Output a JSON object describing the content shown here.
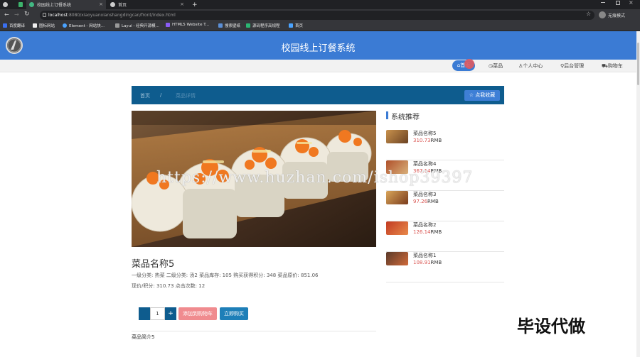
{
  "browser": {
    "tabs": [
      {
        "title": "校园线上订餐系统"
      },
      {
        "title": "首页"
      }
    ],
    "new_tab": "+",
    "url_host": "localhost",
    "url_path": ":8080/xiaoyuanxianshangdingcan/front/index.html",
    "incognito_label": "无痕模式",
    "bookmarks": [
      "百度翻译",
      "图标网站",
      "Element - 网站快...",
      "Layui - 经典开源模...",
      "HTML5 Website T...",
      "搜索壁纸",
      "源码程序高规程",
      "首页"
    ]
  },
  "header": {
    "title": "校园线上订餐系统"
  },
  "nav": {
    "home": "首页",
    "dishes": "菜品",
    "profile": "个人中心",
    "admin": "后台管理",
    "cart": "购物车"
  },
  "breadcrumb": {
    "home": "首页",
    "separator": "/",
    "current": "菜品详情"
  },
  "favorite_button": "☆ 点我收藏",
  "dish": {
    "name": "菜品名称5",
    "info_line1": "一级分类: 热菜   二级分类: 汤2   菜品库存: 105   购买获得积分: 348   菜品原价: 851.06",
    "info_line2": "现价/积分: 310.73   点击次数: 12",
    "quantity": "1",
    "qty_plus": "+",
    "add_to_cart": "添加到购物车",
    "buy_now": "立即购买",
    "intro": "菜品简介5"
  },
  "recommend": {
    "title": "系统推荐",
    "unit": "RMB",
    "items": [
      {
        "name": "菜品名称5",
        "price": "310.73"
      },
      {
        "name": "菜品名称4",
        "price": "367.14"
      },
      {
        "name": "菜品名称3",
        "price": "97.26"
      },
      {
        "name": "菜品名称2",
        "price": "126.14"
      },
      {
        "name": "菜品名称1",
        "price": "108.91"
      }
    ]
  },
  "overlay": {
    "watermark": "https://www.huzhan.com/ishop39397",
    "stamp": "毕设代做"
  },
  "colors": {
    "header": "#3b7bd4",
    "breadcrumb": "#0e5c8e",
    "price": "#d9534f",
    "cart_button": "#f08b8f"
  }
}
